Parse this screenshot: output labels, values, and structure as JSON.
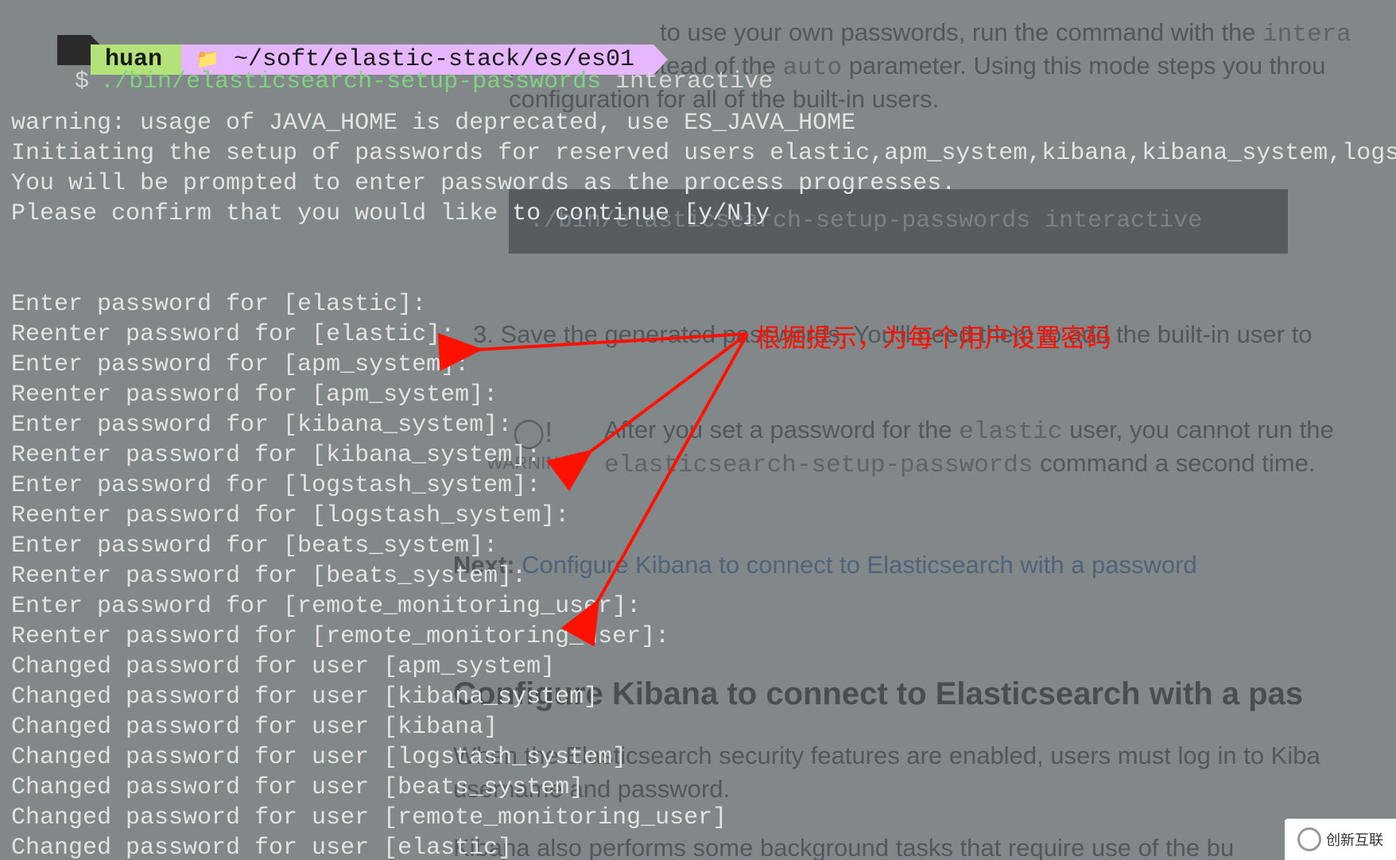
{
  "doc": {
    "p1_a": "to use your own passwords, run the command with the ",
    "p1_code": "intera",
    "p2_a": "parameter instead of the ",
    "p2_code": "auto",
    "p2_b": " parameter. Using this mode steps you throu",
    "p3": "configuration for all of the built-in users.",
    "codeblock": "./bin/elasticsearch-setup-passwords interactive",
    "step3": "3. Save the generated passwords. You'll need them to add the built-in user to",
    "warn_label": "WARNING",
    "warn1_a": "After you set a password for the ",
    "warn1_code": "elastic",
    "warn1_b": " user, you cannot run the",
    "warn2_code": "elasticsearch-setup-passwords",
    "warn2_b": " command a second time.",
    "next_label": "Next: ",
    "next_link": "Configure Kibana to connect to Elasticsearch with a password",
    "h2": "Configure Kibana to connect to Elasticsearch with a pas",
    "p4": "When the Elasticsearch security features are enabled, users must log in to Kiba",
    "p5": "username and password.",
    "p6": "Kibana also performs some background tasks that require use of the bu"
  },
  "term": {
    "user": "huan",
    "path": "~/soft/elastic-stack/es/es01",
    "cmd": "./bin/elasticsearch-setup-passwords",
    "arg": "interactive",
    "lines": [
      "",
      "warning: usage of JAVA_HOME is deprecated, use ES_JAVA_HOME",
      "Initiating the setup of passwords for reserved users elastic,apm_system,kibana,kibana_system,logs",
      "You will be prompted to enter passwords as the process progresses.",
      "Please confirm that you would like to continue [y/N]y",
      "",
      "",
      "Enter password for [elastic]:",
      "Reenter password for [elastic]:",
      "Enter password for [apm_system]:",
      "Reenter password for [apm_system]:",
      "Enter password for [kibana_system]:",
      "Reenter password for [kibana_system]:",
      "Enter password for [logstash_system]:",
      "Reenter password for [logstash_system]:",
      "Enter password for [beats_system]:",
      "Reenter password for [beats_system]:",
      "Enter password for [remote_monitoring_user]:",
      "Reenter password for [remote_monitoring_user]:",
      "Changed password for user [apm_system]",
      "Changed password for user [kibana_system]",
      "Changed password for user [kibana]",
      "Changed password for user [logstash_system]",
      "Changed password for user [beats_system]",
      "Changed password for user [remote_monitoring_user]",
      "Changed password for user [elastic]"
    ]
  },
  "annotation": {
    "text": "根据提示，为每个用户设置密码"
  },
  "watermark": {
    "text": "创新互联"
  }
}
